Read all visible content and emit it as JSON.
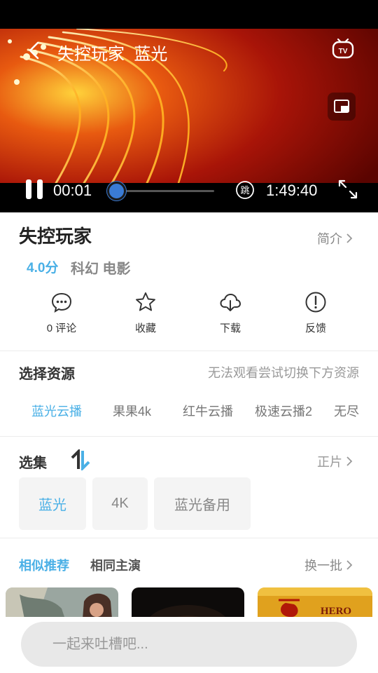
{
  "player": {
    "title": "失控玩家  蓝光",
    "current_time": "00:01",
    "total_time": "1:49:40",
    "progress": 0.0003,
    "skip_glyph": "跳"
  },
  "movie": {
    "title": "失控玩家",
    "intro_label": "简介",
    "score": "4.0分",
    "genre": "科幻 电影"
  },
  "actions": [
    {
      "label": "0 评论",
      "icon": "comment-icon"
    },
    {
      "label": "收藏",
      "icon": "star-icon"
    },
    {
      "label": "下载",
      "icon": "cloud-download-icon"
    },
    {
      "label": "反馈",
      "icon": "alert-circle-icon"
    }
  ],
  "source": {
    "title": "选择资源",
    "hint": "无法观看尝试切换下方资源",
    "tabs": [
      "蓝光云播",
      "果果4k",
      "红牛云播",
      "极速云播2",
      "无尽"
    ],
    "active_index": 0
  },
  "episodes": {
    "title": "选集",
    "link_label": "正片",
    "items": [
      "蓝光",
      "4K",
      "蓝光备用"
    ],
    "active_index": 0
  },
  "recommend": {
    "tabs": [
      "相似推荐",
      "相同主演"
    ],
    "active_index": 0,
    "refresh_label": "换一批",
    "poster_text": "HERO"
  },
  "comment": {
    "placeholder": "一起来吐槽吧..."
  },
  "colors": {
    "accent": "#4ab0e6",
    "player_red": "#b01808",
    "knob": "#3a7bd5"
  }
}
